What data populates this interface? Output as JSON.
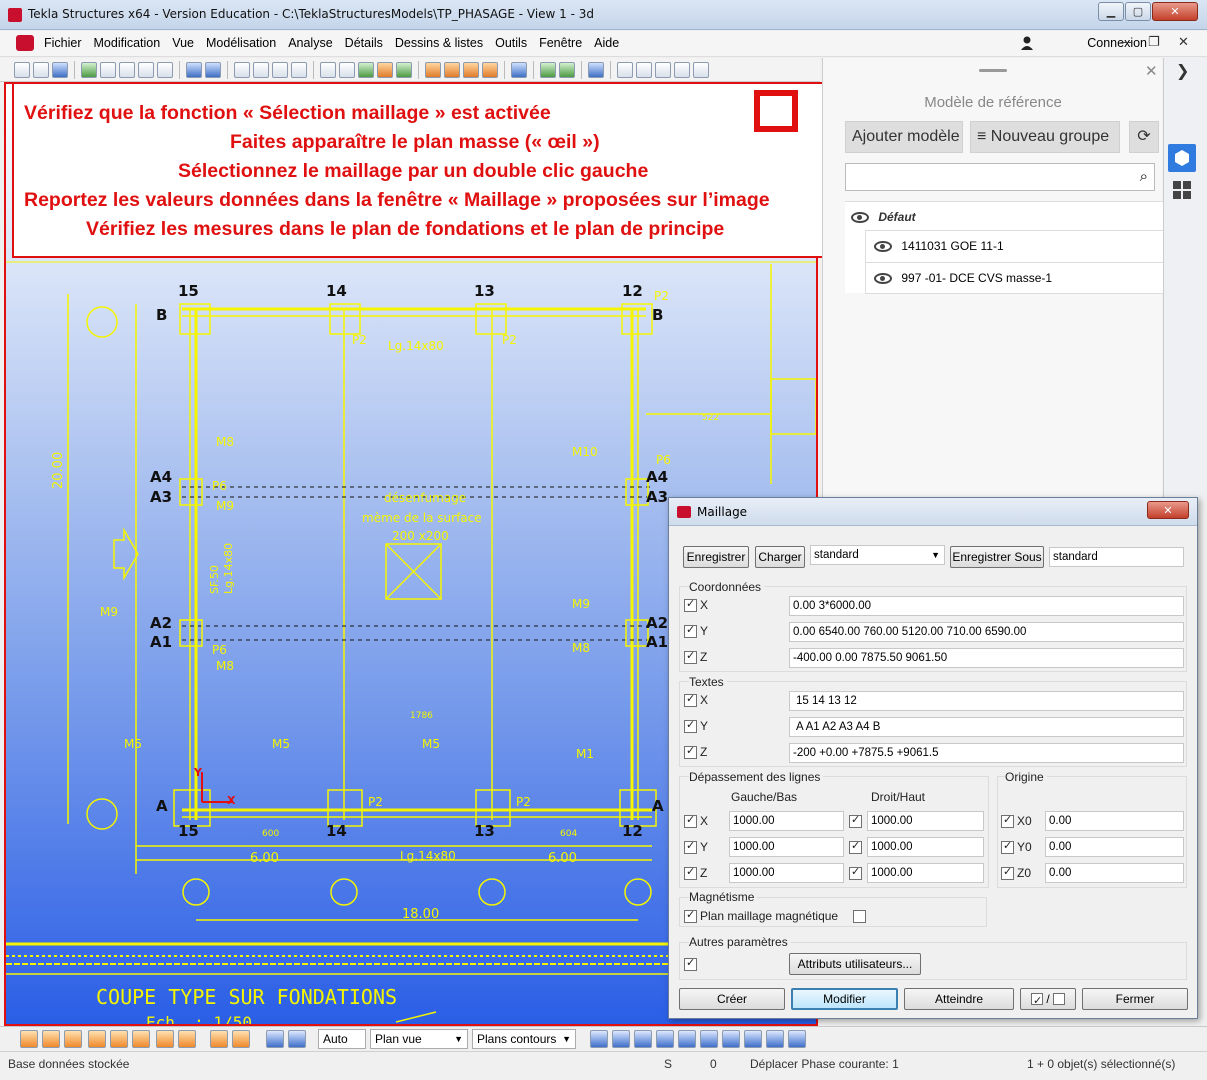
{
  "window": {
    "title": "Tekla Structures x64 - Version Education - C:\\TeklaStructuresModels\\TP_PHASAGE - View 1 - 3d",
    "min": "▁",
    "max": "▢",
    "close": "✕"
  },
  "menu": {
    "items": [
      "Fichier",
      "Modification",
      "Vue",
      "Modélisation",
      "Analyse",
      "Détails",
      "Dessins & listes",
      "Outils",
      "Fenêtre",
      "Aide"
    ],
    "connexion": "Connexion"
  },
  "instructions": {
    "line1": "Vérifiez que la fonction « Sélection maillage » est activée",
    "line2": "Faites apparaître le plan masse (« œil »)",
    "line3": "Sélectionnez le maillage par un double clic gauche",
    "line4": "Reportez les valeurs données dans la fenêtre « Maillage »  proposées  sur l’image",
    "line5": "Vérifiez les mesures dans le plan de fondations et le plan de principe"
  },
  "drawing": {
    "grid_top": [
      "15",
      "14",
      "13",
      "12"
    ],
    "grid_bottom": [
      "15",
      "14",
      "13",
      "12"
    ],
    "axis_left": [
      "B",
      "A4",
      "A3",
      "A2",
      "A1",
      "A"
    ],
    "axis_right": [
      "B",
      "A4",
      "A3",
      "A2",
      "A1",
      "A"
    ],
    "dims_bottom": [
      "6.00",
      "6.00",
      "18.00"
    ],
    "dim_left": "20.00",
    "labels": {
      "m8": "M8",
      "m9": "M9",
      "m10": "M10",
      "m5": "M5",
      "m1": "M1",
      "p2": "P2",
      "p6": "P6",
      "lg": "Lg.14x80",
      "desenfumage": "désenfumage",
      "surface": "mème de la surface",
      "size": "200 x200",
      "sf": "SF.50",
      "dim_1786": "1786",
      "dim_522": "522",
      "dim_600": "600",
      "dim_604": "604"
    },
    "footer_title": "COUPE  TYPE  SUR  FONDATIONS",
    "footer_sub": "Ech. : 1/50"
  },
  "ref_panel": {
    "title": "Modèle de référence",
    "add_model": "Ajouter modèle",
    "new_group": "Nouveau groupe",
    "refresh": "⟳",
    "search_icon": "⌕",
    "group": "Défaut",
    "items": [
      "1411031 GOE 11-1",
      "997 -01- DCE CVS masse-1"
    ]
  },
  "dialog": {
    "title": "Maillage",
    "save": "Enregistrer",
    "load": "Charger",
    "preset": "standard",
    "save_as": "Enregistrer Sous",
    "save_as_name": "standard",
    "coords_label": "Coordonnées",
    "coords": {
      "x_label": "X",
      "x": "0.00 3*6000.00",
      "y_label": "Y",
      "y": "0.00 6540.00 760.00 5120.00 710.00 6590.00",
      "z_label": "Z",
      "z": "-400.00 0.00 7875.50 9061.50"
    },
    "texts_label": "Textes",
    "texts": {
      "x_label": "X",
      "x": "15 14 13 12",
      "y_label": "Y",
      "y": "A A1 A2 A3 A4 B",
      "z_label": "Z",
      "z": "-200 +0.00 +7875.5 +9061.5"
    },
    "overflow_label": "Dépassement des lignes",
    "left_bottom": "Gauche/Bas",
    "right_top": "Droit/Haut",
    "origin_label": "Origine",
    "overflow": {
      "x_label": "X",
      "y_label": "Y",
      "z_label": "Z",
      "x_lb": "1000.00",
      "x_rt": "1000.00",
      "y_lb": "1000.00",
      "y_rt": "1000.00",
      "z_lb": "1000.00",
      "z_rt": "1000.00"
    },
    "origin": {
      "x0_label": "X0",
      "x0": "0.00",
      "y0_label": "Y0",
      "y0": "0.00",
      "z0_label": "Z0",
      "z0": "0.00"
    },
    "magnet_label": "Magnétisme",
    "magnet_plan": "Plan maillage magnétique",
    "other_label": "Autres paramètres",
    "user_attr": "Attributs utilisateurs...",
    "create": "Créer",
    "modify": "Modifier",
    "reach": "Atteindre",
    "toggle": "/",
    "close": "Fermer"
  },
  "bottombar": {
    "auto": "Auto",
    "plan_vue": "Plan vue",
    "plans_contours": "Plans contours"
  },
  "status": {
    "db": "Base données stockée",
    "s": "S",
    "count": "0",
    "phase": "Déplacer Phase courante: 1",
    "selected": "1 + 0 objet(s) sélectionné(s)"
  }
}
